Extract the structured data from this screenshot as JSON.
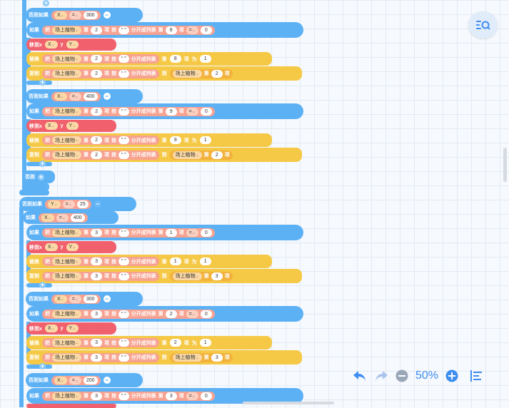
{
  "labels": {
    "else_if": "否则如果",
    "if": "如果",
    "else": "否则",
    "move_x": "移到x",
    "y": "y",
    "replace": "替换",
    "copy": "复制",
    "take": "把",
    "item": "项",
    "split_by": "按",
    "split_tail": "分开成列表",
    "nth": "第",
    "to": "为",
    "to_list": "到"
  },
  "values": {
    "var_x": "X",
    "var_y": "Y",
    "list_name": "场上植物",
    "eq": "=",
    "sep_char": "“ ”",
    "zero": "0",
    "one": "1"
  },
  "blocks": [
    {
      "cond_var": "X",
      "cond_val": "300",
      "idx": "2",
      "col": "8"
    },
    {
      "cond_var": "X",
      "cond_val": "400",
      "idx": "2",
      "col": "9"
    },
    {
      "cond_var": "X",
      "cond_val": "400",
      "idx": "3",
      "col": "1",
      "outer_var": "Y",
      "outer_val": "25"
    },
    {
      "cond_var": "X",
      "cond_val": "300",
      "idx": "3",
      "col": "2"
    },
    {
      "cond_var": "X",
      "cond_val": "200",
      "idx": "3",
      "col": "3"
    }
  ],
  "toolbar": {
    "zoom_level": "50%",
    "undo_icon": "undo-icon",
    "redo_icon": "redo-icon",
    "zoom_out_icon": "zoom-out-icon",
    "zoom_in_icon": "zoom-in-icon",
    "align_icon": "align-left-icon",
    "search_icon": "list-search-icon"
  },
  "colors": {
    "control": "#5cb1f5",
    "move": "#f0616d",
    "replace": "#f5c845",
    "text": "#f3a37c",
    "accent": "#3f8ef0"
  }
}
